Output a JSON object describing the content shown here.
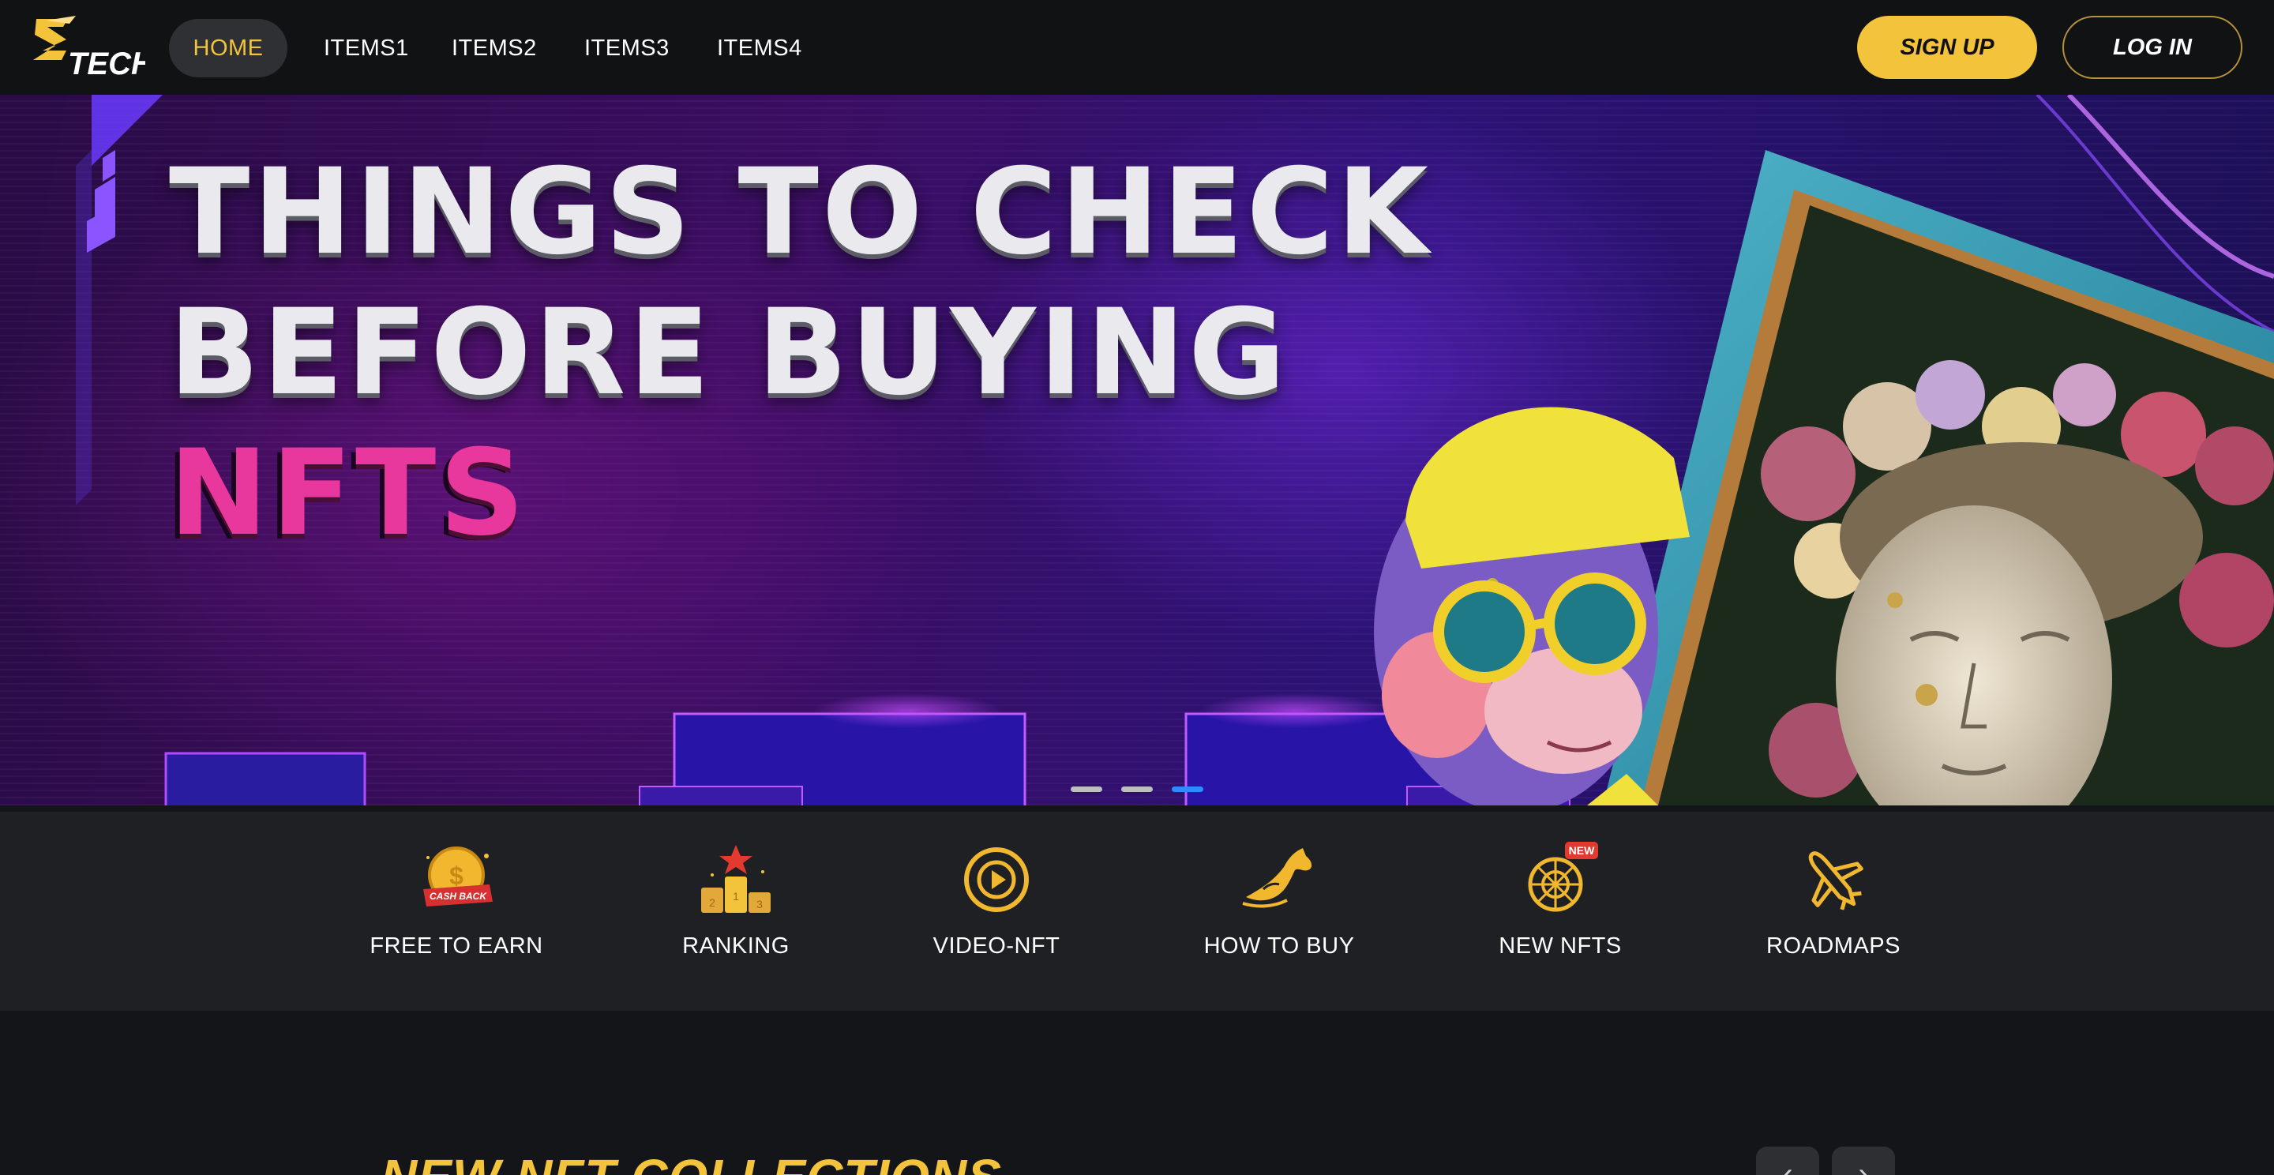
{
  "brand": {
    "logo_text": "TECH",
    "accent": "#f3c33c",
    "hero_pink": "#e8379d"
  },
  "nav": {
    "items": [
      {
        "label": "HOME",
        "active": true
      },
      {
        "label": "ITEMS1"
      },
      {
        "label": "ITEMS2"
      },
      {
        "label": "ITEMS3"
      },
      {
        "label": "ITEMS4"
      }
    ],
    "signup_label": "SIGN UP",
    "login_label": "LOG IN"
  },
  "hero": {
    "headline_line1": "THINGS TO CHECK",
    "headline_line2": "BEFORE BUYING",
    "headline_line3": "NFTS",
    "slides_total": 3,
    "active_slide": 3
  },
  "features": [
    {
      "label": "FREE TO EARN",
      "icon": "cashback-coin-icon",
      "icon_text": "CASH BACK"
    },
    {
      "label": "RANKING",
      "icon": "podium-icon"
    },
    {
      "label": "VIDEO-NFT",
      "icon": "play-circle-icon"
    },
    {
      "label": "HOW TO BUY",
      "icon": "horse-icon"
    },
    {
      "label": "NEW NFTS",
      "icon": "wheel-icon",
      "badge": "NEW"
    },
    {
      "label": "ROADMAPS",
      "icon": "airplane-icon"
    }
  ],
  "section": {
    "title": "NEW NFT COLLECTIONS",
    "prev_label": "‹",
    "next_label": "›"
  }
}
